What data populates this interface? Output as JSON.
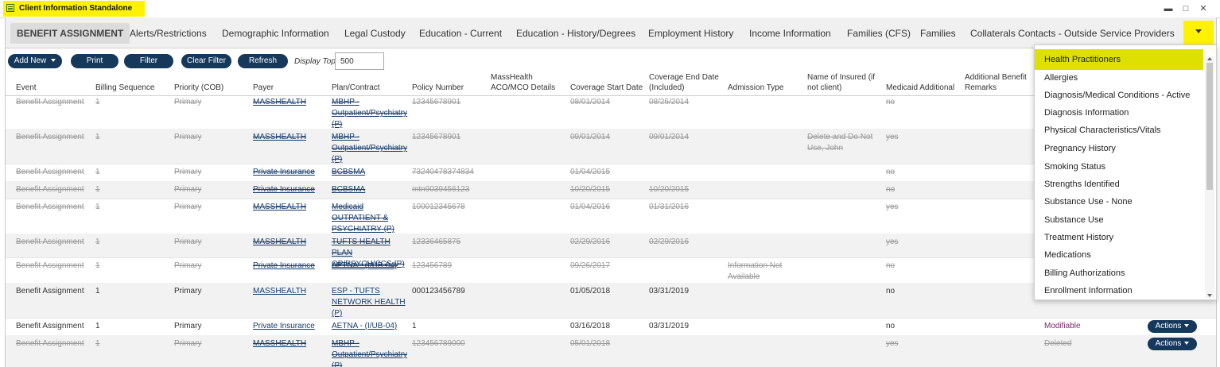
{
  "window": {
    "title": "Client Information Standalone",
    "minimize_glyph": "▬",
    "restore_glyph": "□",
    "close_glyph": "✕"
  },
  "tabs": [
    "BENEFIT ASSIGNMENT",
    "Alerts/Restrictions",
    "Demographic Information",
    "Legal Custody",
    "Education - Current",
    "Education - History/Degrees",
    "Employment History",
    "Income Information",
    "Families (CFS)",
    "Families",
    "Collaterals Contacts - Outside Service Providers"
  ],
  "toolbar": {
    "new": "Add New",
    "print": "Print",
    "filter": "Filter",
    "clear": "Clear Filter",
    "refresh": "Refresh",
    "display_top_label": "Display Top",
    "display_top_value": "500"
  },
  "columns": [
    "Event",
    "Billing Sequence",
    "Priority (COB)",
    "Payer",
    "Plan/Contract",
    "Policy Number",
    "MassHealth ACO/MCO Details",
    "Coverage Start Date",
    "Coverage End Date (Included)",
    "Admission Type",
    "Name of Insured (if not client)",
    "Medicaid Additional",
    "Additional Benefit Remarks"
  ],
  "rows": [
    {
      "deleted": true,
      "event": "Benefit Assignment",
      "seq": "1",
      "priority": "Primary",
      "payer": "MASSHEALTH",
      "plan": "MBHP - Outpatient/Psychiatry (P)",
      "policy": "12345678901",
      "start": "08/01/2014",
      "end": "08/25/2014",
      "admission": "",
      "insured": "",
      "medicaid": "no",
      "status": ""
    },
    {
      "deleted": true,
      "event": "Benefit Assignment",
      "seq": "1",
      "priority": "Primary",
      "payer": "MASSHEALTH",
      "plan": "MBHP - Outpatient/Psychiatry (P)",
      "policy": "12345678901",
      "start": "09/01/2014",
      "end": "09/01/2014",
      "admission": "",
      "insured": "Delete and Do Not Use, John",
      "medicaid": "yes",
      "status": ""
    },
    {
      "deleted": true,
      "event": "Benefit Assignment",
      "seq": "1",
      "priority": "Primary",
      "payer": "Private Insurance",
      "plan": "BCBSMA",
      "policy": "73240478374834",
      "start": "01/04/2015",
      "end": "",
      "admission": "",
      "insured": "",
      "medicaid": "no",
      "status": ""
    },
    {
      "deleted": true,
      "event": "Benefit Assignment",
      "seq": "1",
      "priority": "Primary",
      "payer": "Private Insurance",
      "plan": "BCBSMA",
      "policy": "mtn9039456123",
      "start": "10/20/2015",
      "end": "10/20/2015",
      "admission": "",
      "insured": "",
      "medicaid": "no",
      "status": ""
    },
    {
      "deleted": true,
      "event": "Benefit Assignment",
      "seq": "1",
      "priority": "Primary",
      "payer": "MASSHEALTH",
      "plan": "Medicaid OUTPATIENT & PSYCHIATRY (P)",
      "policy": "100012345678",
      "start": "01/04/2016",
      "end": "01/31/2016",
      "admission": "",
      "insured": "",
      "medicaid": "yes",
      "status": ""
    },
    {
      "deleted": true,
      "event": "Benefit Assignment",
      "seq": "1",
      "priority": "Primary",
      "payer": "MASSHEALTH",
      "plan": "TUFTS HEALTH PLAN OP/PSYCH/CCS (P)",
      "policy": "12336465875",
      "start": "02/29/2016",
      "end": "02/29/2016",
      "admission": "",
      "insured": "",
      "medicaid": "yes",
      "status": ""
    },
    {
      "deleted": true,
      "event": "Benefit Assignment",
      "seq": "1",
      "priority": "Primary",
      "payer": "Private Insurance",
      "plan": "AETNA - (I/UB-04)",
      "policy": "123456789",
      "start": "09/26/2017",
      "end": "",
      "admission": "Information Not Available",
      "insured": "",
      "medicaid": "no",
      "status": ""
    },
    {
      "deleted": false,
      "event": "Benefit Assignment",
      "seq": "1",
      "priority": "Primary",
      "payer": "MASSHEALTH",
      "plan": "ESP - TUFTS NETWORK HEALTH (P)",
      "policy": "000123456789",
      "start": "01/05/2018",
      "end": "03/31/2019",
      "admission": "",
      "insured": "",
      "medicaid": "no",
      "status": ""
    },
    {
      "deleted": false,
      "event": "Benefit Assignment",
      "seq": "1",
      "priority": "Primary",
      "payer": "Private Insurance",
      "plan": "AETNA - (I/UB-04)",
      "policy": "1",
      "start": "03/16/2018",
      "end": "03/31/2019",
      "admission": "",
      "insured": "",
      "medicaid": "no",
      "status": "Modifiable",
      "actions": "Actions"
    },
    {
      "deleted": true,
      "event": "Benefit Assignment",
      "seq": "1",
      "priority": "Primary",
      "payer": "MASSHEALTH",
      "plan": "MBHP - Outpatient/Psychiatry (P)",
      "policy": "123456789000",
      "start": "05/01/2018",
      "end": "",
      "admission": "",
      "insured": "",
      "medicaid": "yes",
      "status": "Deleted",
      "actions": "Actions"
    }
  ],
  "dropdown": [
    "Health Practitioners",
    "Allergies",
    "Diagnosis/Medical Conditions - Active",
    "Diagnosis Information",
    "Physical Characteristics/Vitals",
    "Pregnancy History",
    "Smoking Status",
    "Strengths Identified",
    "Substance Use - None",
    "Substance Use",
    "Treatment History",
    "Medications",
    "Billing Authorizations",
    "Enrollment Information"
  ],
  "colors": {
    "highlight": "#fff200",
    "button": "#15385b"
  }
}
